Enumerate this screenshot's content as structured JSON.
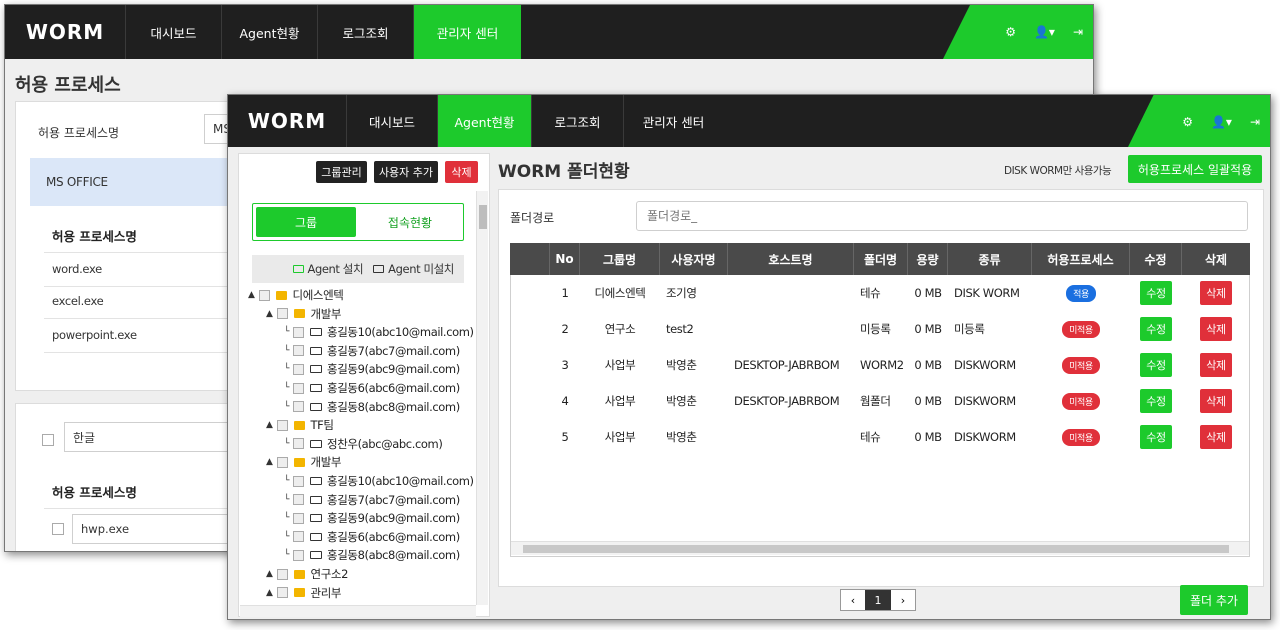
{
  "back_window": {
    "logo": "WORM",
    "nav": [
      "대시보드",
      "Agent현황",
      "로그조회",
      "관리자 센터"
    ],
    "active_nav": 3,
    "page_title": "허용 프로세스",
    "process_name_label": "허용 프로세스명",
    "process_name_value": "MS",
    "selected_group": "MS OFFICE",
    "col_header": "허용 프로세스명",
    "processes": [
      "word.exe",
      "excel.exe",
      "powerpoint.exe"
    ],
    "group2_name": "한글",
    "col_header2": "허용 프로세스명",
    "processes2": [
      "hwp.exe"
    ]
  },
  "front_window": {
    "logo": "WORM",
    "nav": [
      "대시보드",
      "Agent현황",
      "로그조회",
      "관리자 센터"
    ],
    "active_nav": 1,
    "sidebar": {
      "group_manage_btn": "그룹관리",
      "add_user_btn": "사용자 추가",
      "delete_btn": "삭제",
      "tab_group": "그룹",
      "tab_status": "접속현황",
      "legend_installed": "Agent 설치",
      "legend_not_installed": "Agent 미설치",
      "tree": [
        {
          "level": 0,
          "type": "folder",
          "label": "디에스엔텍"
        },
        {
          "level": 1,
          "type": "folder",
          "label": "개발부"
        },
        {
          "level": 2,
          "type": "pc",
          "label": "홍길동10(abc10@mail.com)"
        },
        {
          "level": 2,
          "type": "pc",
          "label": "홍길동7(abc7@mail.com)"
        },
        {
          "level": 2,
          "type": "pc",
          "label": "홍길동9(abc9@mail.com)"
        },
        {
          "level": 2,
          "type": "pc",
          "label": "홍길동6(abc6@mail.com)"
        },
        {
          "level": 2,
          "type": "pc",
          "label": "홍길동8(abc8@mail.com)"
        },
        {
          "level": 1,
          "type": "folder",
          "label": "TF팀"
        },
        {
          "level": 2,
          "type": "pc",
          "label": "정찬우(abc@abc.com)"
        },
        {
          "level": 1,
          "type": "folder",
          "label": "개발부"
        },
        {
          "level": 2,
          "type": "pc",
          "label": "홍길동10(abc10@mail.com)"
        },
        {
          "level": 2,
          "type": "pc",
          "label": "홍길동7(abc7@mail.com)"
        },
        {
          "level": 2,
          "type": "pc",
          "label": "홍길동9(abc9@mail.com)"
        },
        {
          "level": 2,
          "type": "pc",
          "label": "홍길동6(abc6@mail.com)"
        },
        {
          "level": 2,
          "type": "pc",
          "label": "홍길동8(abc8@mail.com)"
        },
        {
          "level": 1,
          "type": "folder",
          "label": "연구소2"
        },
        {
          "level": 1,
          "type": "folder",
          "label": "관리부"
        }
      ]
    },
    "main": {
      "title": "WORM 폴더현황",
      "note": "DISK WORM만 사용가능",
      "apply_btn": "허용프로세스 일괄적용",
      "path_label": "폴더경로",
      "path_placeholder": "폴더경로_",
      "columns": [
        "No",
        "그룹명",
        "사용자명",
        "호스트명",
        "폴더명",
        "용량",
        "종류",
        "허용프로세스",
        "수정",
        "삭제"
      ],
      "rows": [
        {
          "no": "1",
          "group": "디에스엔텍",
          "user": "조기영",
          "host": "",
          "folder": "테슈",
          "size": "0 MB",
          "kind": "DISK WORM",
          "proc": "적용",
          "applied": true
        },
        {
          "no": "2",
          "group": "연구소",
          "user": "test2",
          "host": "",
          "folder": "미등록",
          "size": "0 MB",
          "kind": "미등록",
          "proc": "미적용",
          "applied": false
        },
        {
          "no": "3",
          "group": "사업부",
          "user": "박영춘",
          "host": "DESKTOP-JABRBOM",
          "folder": "WORM2",
          "size": "0 MB",
          "kind": "DISKWORM",
          "proc": "미적용",
          "applied": false
        },
        {
          "no": "4",
          "group": "사업부",
          "user": "박영춘",
          "host": "DESKTOP-JABRBOM",
          "folder": "웜폴더",
          "size": "0 MB",
          "kind": "DISKWORM",
          "proc": "미적용",
          "applied": false
        },
        {
          "no": "5",
          "group": "사업부",
          "user": "박영춘",
          "host": "",
          "folder": "테슈",
          "size": "0 MB",
          "kind": "DISKWORM",
          "proc": "미적용",
          "applied": false
        }
      ],
      "edit_label": "수정",
      "delete_label": "삭제",
      "page": "1",
      "add_folder_btn": "폴더 추가"
    },
    "colors": {
      "accent": "#1dca2c",
      "danger": "#e0303a",
      "applied": "#1a6fe0"
    }
  }
}
